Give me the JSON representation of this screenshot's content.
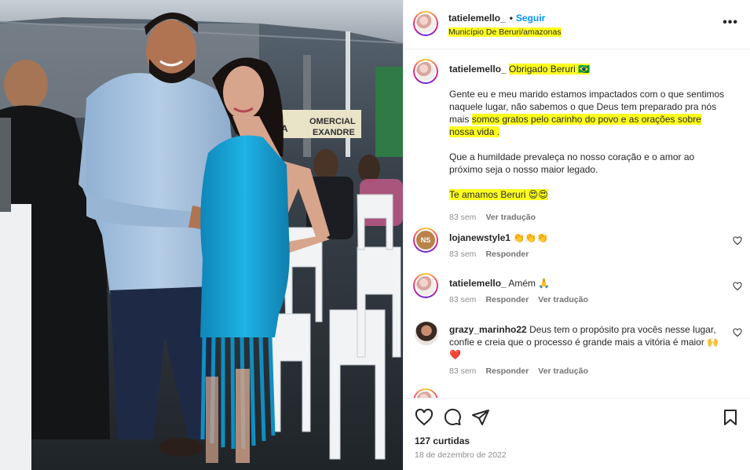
{
  "post": {
    "username": "tatielemello_",
    "follow_label": "Seguir",
    "location": "Município De Beruri/amazonas"
  },
  "photo": {
    "sign_text": "OMERCIAL",
    "sign_text2": "EXANDRE",
    "sign_prefix": "A"
  },
  "caption": {
    "username": "tatielemello_",
    "highlight_lead": "Obrigado Beruri 🇧🇷",
    "paragraph1_plain": "Gente eu e meu marido estamos impactados com o que sentimos naquele lugar, não sabemos o que Deus tem preparado pra nós mais",
    "paragraph1_highlight": "somos gratos pelo carinho do povo e as orações sobre nossa vida .",
    "paragraph2": "Que a humildade prevaleça no nosso coração e o amor ao próximo seja o nosso maior legado.",
    "closing_highlight": "Te amamos Beruri 😍😍",
    "age": "83 sem",
    "translate": "Ver tradução"
  },
  "comments": [
    {
      "username": "lojanewstyle1",
      "text": "👏👏👏",
      "age": "83 sem",
      "reply": "Responder",
      "avatar_text": "NS"
    },
    {
      "username": "tatielemello_",
      "text": "Amém 🙏",
      "age": "83 sem",
      "reply": "Responder",
      "translate": "Ver tradução"
    },
    {
      "username": "grazy_marinho22",
      "text": "Deus tem o propósito pra vocês nesse lugar, confie e creia que o processo é grande mais a vitória é maior 🙌❤️",
      "age": "83 sem",
      "reply": "Responder",
      "translate": "Ver tradução"
    }
  ],
  "footer": {
    "likes": "127 curtidas",
    "date": "18 de dezembro de 2022"
  },
  "icons": [
    "more-icon",
    "heart-icon",
    "comment-icon",
    "share-icon",
    "bookmark-icon"
  ],
  "colors": {
    "highlight": "#ffff1f",
    "follow": "#0095f6",
    "dress": "#1aa6d6"
  }
}
